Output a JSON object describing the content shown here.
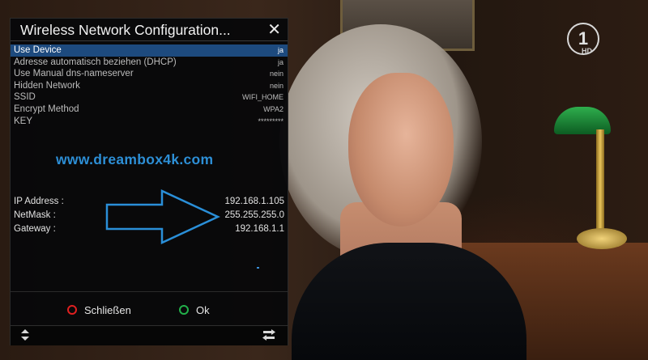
{
  "dialog": {
    "title": "Wireless Network Configuration...",
    "close_icon": "close-icon"
  },
  "settings": [
    {
      "label": "Use Device",
      "value": "ja",
      "selected": true
    },
    {
      "label": "Adresse automatisch beziehen (DHCP)",
      "value": "ja"
    },
    {
      "label": "Use Manual dns-nameserver",
      "value": "nein"
    },
    {
      "label": "Hidden Network",
      "value": "nein"
    },
    {
      "label": "SSID",
      "value": "WIFI_HOME"
    },
    {
      "label": "Encrypt Method",
      "value": "WPA2"
    },
    {
      "label": "KEY",
      "value": "*********"
    }
  ],
  "watermark": "www.dreambox4k.com",
  "network_info": [
    {
      "label": "IP Address :",
      "value": "192.168.1.105"
    },
    {
      "label": "NetMask :",
      "value": "255.255.255.0"
    },
    {
      "label": "Gateway :",
      "value": "192.168.1.1"
    }
  ],
  "buttons": {
    "red_label": "Schließen",
    "green_label": "Ok"
  },
  "footer_icons": {
    "left": "up-down-arrows-icon",
    "right": "swap-arrows-icon"
  },
  "channel": {
    "logo": "1",
    "hd": "HD"
  },
  "colors": {
    "selection": "#1d4a7e",
    "brand_blue": "#2d8fd6",
    "red_key": "#e02020",
    "green_key": "#22b04a"
  }
}
